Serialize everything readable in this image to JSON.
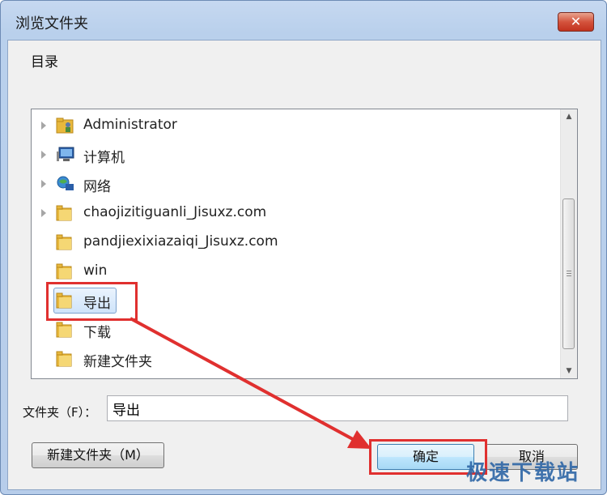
{
  "window": {
    "title": "浏览文件夹",
    "close_label": "✕"
  },
  "description": "目录",
  "tree": {
    "items": [
      {
        "label": "Administrator",
        "icon": "user-folder-icon",
        "has_expander": true
      },
      {
        "label": "计算机",
        "icon": "computer-icon",
        "has_expander": true
      },
      {
        "label": "网络",
        "icon": "network-icon",
        "has_expander": true
      },
      {
        "label": "chaojizitiguanli_Jisuxz.com",
        "icon": "folder-icon",
        "has_expander": true
      },
      {
        "label": "pandjiexixiazaiqi_Jisuxz.com",
        "icon": "folder-icon",
        "has_expander": false
      },
      {
        "label": "win",
        "icon": "folder-icon",
        "has_expander": false
      },
      {
        "label": "导出",
        "icon": "folder-icon",
        "has_expander": false,
        "selected": true
      },
      {
        "label": "下载",
        "icon": "folder-icon",
        "has_expander": false
      },
      {
        "label": "新建文件夹",
        "icon": "folder-icon",
        "has_expander": false
      }
    ]
  },
  "folder": {
    "label": "文件夹（F）：",
    "value": "导出"
  },
  "buttons": {
    "new_folder": "新建文件夹（M）",
    "ok": "确定",
    "cancel": "取消"
  },
  "watermark": "极速下载站",
  "colors": {
    "highlight": "#e0302f",
    "folder": "#e8b83c"
  }
}
